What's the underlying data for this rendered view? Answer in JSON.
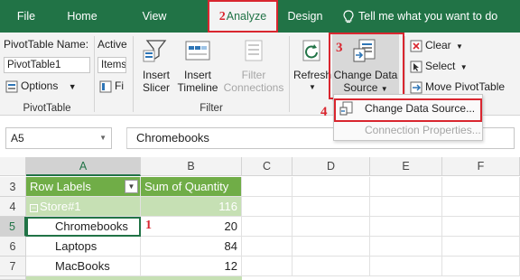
{
  "tabs": [
    {
      "label": "File"
    },
    {
      "label": "Home"
    },
    {
      "label": "View"
    },
    {
      "label": "Analyze",
      "step": "2"
    },
    {
      "label": "Design"
    },
    {
      "label": "Tell me what you want to do"
    }
  ],
  "ribbon": {
    "pivottable": {
      "name_label": "PivotTable Name:",
      "name_value": "PivotTable1",
      "options_label": "Options",
      "group_label": "PivotTable"
    },
    "active_field": {
      "label": "Active",
      "value": "Items",
      "fi_label": "Fi"
    },
    "filter": {
      "insert_slicer": [
        "Insert",
        "Slicer"
      ],
      "insert_timeline": [
        "Insert",
        "Timeline"
      ],
      "filter_connections": [
        "Filter",
        "Connections"
      ],
      "group_label": "Filter"
    },
    "data": {
      "refresh": "Refresh",
      "change_data_source": [
        "Change Data",
        "Source"
      ],
      "step": "3"
    },
    "actions": {
      "clear": "Clear",
      "select": "Select",
      "move": "Move PivotTable"
    }
  },
  "dropdown": {
    "step": "4",
    "items": [
      {
        "label": "Change Data Source...",
        "enabled": true
      },
      {
        "label": "Connection Properties...",
        "enabled": false
      }
    ]
  },
  "formula_bar": {
    "name_box": "A5",
    "formula": "Chromebooks"
  },
  "grid": {
    "columns": [
      "A",
      "B",
      "C",
      "D",
      "E",
      "F"
    ],
    "rows": [
      {
        "num": "3",
        "a": "Row Labels",
        "b": "Sum of Quantity",
        "type": "header"
      },
      {
        "num": "4",
        "a": "Store#1",
        "b": "116",
        "type": "group"
      },
      {
        "num": "5",
        "a": "Chromebooks",
        "b": "20",
        "type": "item",
        "step": "1"
      },
      {
        "num": "6",
        "a": "Laptops",
        "b": "84",
        "type": "item"
      },
      {
        "num": "7",
        "a": "MacBooks",
        "b": "12",
        "type": "item"
      }
    ]
  },
  "colors": {
    "excel_green": "#217346",
    "highlight_red": "#d9262f",
    "pivot_header": "#70ad47",
    "pivot_group": "#c6e0b4"
  }
}
